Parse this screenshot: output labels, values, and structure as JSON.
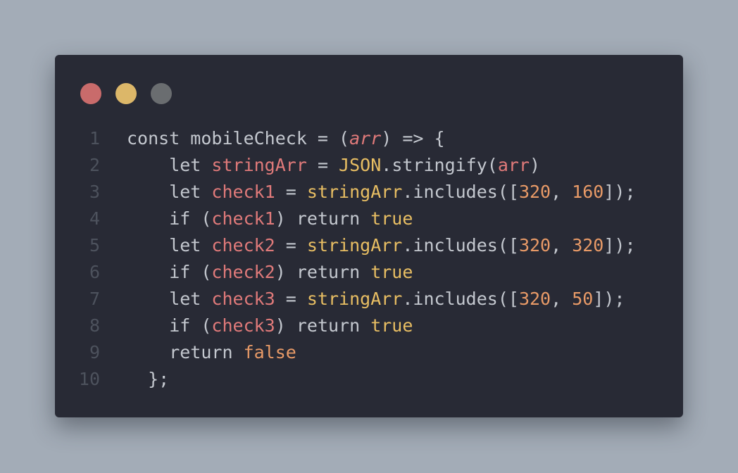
{
  "window": {
    "controls": [
      {
        "name": "close-dot",
        "color": "#c96b6b"
      },
      {
        "name": "minimize-dot",
        "color": "#dcb769"
      },
      {
        "name": "zoom-dot",
        "color": "#6a6d70"
      }
    ]
  },
  "code": {
    "lines": [
      {
        "number": "1",
        "tokens": [
          {
            "t": "const mobileCheck = (",
            "c": "k"
          },
          {
            "t": "arr",
            "c": "v it"
          },
          {
            "t": ") => {",
            "c": "k"
          }
        ]
      },
      {
        "number": "2",
        "tokens": [
          {
            "t": "    let ",
            "c": "k"
          },
          {
            "t": "stringArr",
            "c": "v"
          },
          {
            "t": " = ",
            "c": "k"
          },
          {
            "t": "JSON",
            "c": "y"
          },
          {
            "t": ".stringify(",
            "c": "k"
          },
          {
            "t": "arr",
            "c": "v"
          },
          {
            "t": ")",
            "c": "k"
          }
        ]
      },
      {
        "number": "3",
        "tokens": [
          {
            "t": "    let ",
            "c": "k"
          },
          {
            "t": "check1",
            "c": "v"
          },
          {
            "t": " = ",
            "c": "k"
          },
          {
            "t": "stringArr",
            "c": "y"
          },
          {
            "t": ".includes([",
            "c": "k"
          },
          {
            "t": "320",
            "c": "n"
          },
          {
            "t": ", ",
            "c": "k"
          },
          {
            "t": "160",
            "c": "n"
          },
          {
            "t": "]);",
            "c": "k"
          }
        ]
      },
      {
        "number": "4",
        "tokens": [
          {
            "t": "    if (",
            "c": "k"
          },
          {
            "t": "check1",
            "c": "v"
          },
          {
            "t": ") return ",
            "c": "k"
          },
          {
            "t": "true",
            "c": "y"
          }
        ]
      },
      {
        "number": "5",
        "tokens": [
          {
            "t": "    let ",
            "c": "k"
          },
          {
            "t": "check2",
            "c": "v"
          },
          {
            "t": " = ",
            "c": "k"
          },
          {
            "t": "stringArr",
            "c": "y"
          },
          {
            "t": ".includes([",
            "c": "k"
          },
          {
            "t": "320",
            "c": "n"
          },
          {
            "t": ", ",
            "c": "k"
          },
          {
            "t": "320",
            "c": "n"
          },
          {
            "t": "]);",
            "c": "k"
          }
        ]
      },
      {
        "number": "6",
        "tokens": [
          {
            "t": "    if (",
            "c": "k"
          },
          {
            "t": "check2",
            "c": "v"
          },
          {
            "t": ") return ",
            "c": "k"
          },
          {
            "t": "true",
            "c": "y"
          }
        ]
      },
      {
        "number": "7",
        "tokens": [
          {
            "t": "    let ",
            "c": "k"
          },
          {
            "t": "check3",
            "c": "v"
          },
          {
            "t": " = ",
            "c": "k"
          },
          {
            "t": "stringArr",
            "c": "y"
          },
          {
            "t": ".includes([",
            "c": "k"
          },
          {
            "t": "320",
            "c": "n"
          },
          {
            "t": ", ",
            "c": "k"
          },
          {
            "t": "50",
            "c": "n"
          },
          {
            "t": "]);",
            "c": "k"
          }
        ]
      },
      {
        "number": "8",
        "tokens": [
          {
            "t": "    if (",
            "c": "k"
          },
          {
            "t": "check3",
            "c": "v"
          },
          {
            "t": ") return ",
            "c": "k"
          },
          {
            "t": "true",
            "c": "y"
          }
        ]
      },
      {
        "number": "9",
        "tokens": [
          {
            "t": "    return ",
            "c": "k"
          },
          {
            "t": "false",
            "c": "n"
          }
        ]
      },
      {
        "number": "10",
        "tokens": [
          {
            "t": "  };",
            "c": "k"
          }
        ]
      }
    ]
  }
}
